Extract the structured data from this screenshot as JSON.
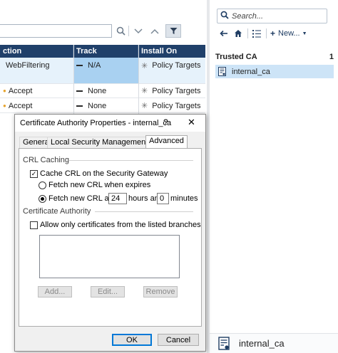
{
  "rulebase": {
    "columns": [
      "ction",
      "Track",
      "Install On"
    ],
    "rows": [
      {
        "action": "WebFiltering",
        "track": "N/A",
        "install_on": "Policy Targets",
        "selected": true
      },
      {
        "action": "Accept",
        "track": "None",
        "install_on": "Policy Targets",
        "selected": false
      },
      {
        "action": "Accept",
        "track": "None",
        "install_on": "Policy Targets",
        "selected": false
      }
    ],
    "toolbar_icons": [
      "search-icon",
      "chevron-down-icon",
      "chevron-up-icon",
      "filter-icon"
    ]
  },
  "objects_pane": {
    "search_placeholder": "Search...",
    "new_label": "New...",
    "category": {
      "label": "Trusted CA",
      "count": "1"
    },
    "items": [
      {
        "name": "internal_ca",
        "icon": "certificate-icon"
      }
    ],
    "bottom_label": "internal_ca"
  },
  "dialog": {
    "title": "Certificate Authority Properties - internal_ca",
    "help": "?",
    "close": "✕",
    "tabs": [
      "General",
      "Local Security Management Server",
      "Advanced"
    ],
    "active_tab": "Advanced",
    "crl_caching": {
      "group_label": "CRL Caching",
      "cache_checkbox": {
        "label": "Cache CRL on the Security Gateway",
        "checked": true
      },
      "radio_expires": {
        "label": "Fetch new CRL when expires",
        "selected": false
      },
      "radio_after": {
        "label": "Fetch new CRL after",
        "selected": true
      },
      "hours_value": "24",
      "hours_label": "hours and",
      "minutes_value": "0",
      "minutes_label": "minutes"
    },
    "certificate_authority": {
      "group_label": "Certificate Authority",
      "allow_checkbox": {
        "label": "Allow only certificates from the listed branches",
        "checked": false
      },
      "buttons": [
        "Add...",
        "Edit...",
        "Remove"
      ]
    },
    "ok_label": "OK",
    "cancel_label": "Cancel"
  },
  "colors": {
    "header_bg": "#20406a",
    "selection": "#cde4f7",
    "accent": "#0078d7"
  }
}
